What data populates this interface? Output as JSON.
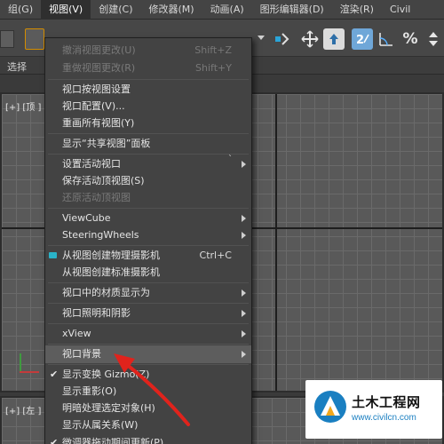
{
  "menubar": {
    "items": [
      {
        "label": "组(G)"
      },
      {
        "label": "视图(V)"
      },
      {
        "label": "创建(C)"
      },
      {
        "label": "修改器(M)"
      },
      {
        "label": "动画(A)"
      },
      {
        "label": "图形编辑器(D)"
      },
      {
        "label": "渲染(R)"
      },
      {
        "label": "Civil"
      }
    ]
  },
  "ribbon": {
    "label": "选择"
  },
  "viewports": {
    "top_label": "[+] [顶 ] [",
    "left_label": "[+] [左 ] ["
  },
  "view_menu": {
    "items": [
      {
        "label": "撤消视图更改(U)",
        "shortcut": "Shift+Z"
      },
      {
        "label": "重做视图更改(R)",
        "shortcut": "Shift+Y"
      },
      {
        "label": "视口按视图设置"
      },
      {
        "label": "视口配置(V)..."
      },
      {
        "label": "重画所有视图(Y)"
      },
      {
        "label": "显示“共享视图”面板"
      },
      {
        "label": "设置活动视口"
      },
      {
        "label": "保存活动顶视图(S)"
      },
      {
        "label": "还原活动顶视图"
      },
      {
        "label": "ViewCube"
      },
      {
        "label": "SteeringWheels"
      },
      {
        "label": "从视图创建物理摄影机",
        "shortcut": "Ctrl+C"
      },
      {
        "label": "从视图创建标准摄影机"
      },
      {
        "label": "视口中的材质显示为"
      },
      {
        "label": "视口照明和阴影"
      },
      {
        "label": "xView"
      },
      {
        "label": "视口背景"
      },
      {
        "label": "显示变换 Gizmo(Z)"
      },
      {
        "label": "显示重影(O)"
      },
      {
        "label": "明暗处理选定对象(H)"
      },
      {
        "label": "显示从属关系(W)"
      },
      {
        "label": "微调器拖动期间更新(P)"
      }
    ],
    "tick_mark": "`"
  },
  "watermark": {
    "title": "土木工程网",
    "url": "www.civilcn.com"
  },
  "colors": {
    "accent_active": "#6fa7d8",
    "annotation_arrow": "#e0231c",
    "camera_icon": "#2ab3c8",
    "watermark_url": "#1a7fc1"
  },
  "icons": [
    "select-cursor-icon",
    "snap-toggle-icon",
    "move-icon",
    "keyframe-icon",
    "snap-2d-icon",
    "angle-snap-icon",
    "percent-snap-icon",
    "spinner-snap-icon",
    "camera-icon",
    "checkmark-icon",
    "submenu-arrow-icon",
    "civilcn-logo"
  ]
}
